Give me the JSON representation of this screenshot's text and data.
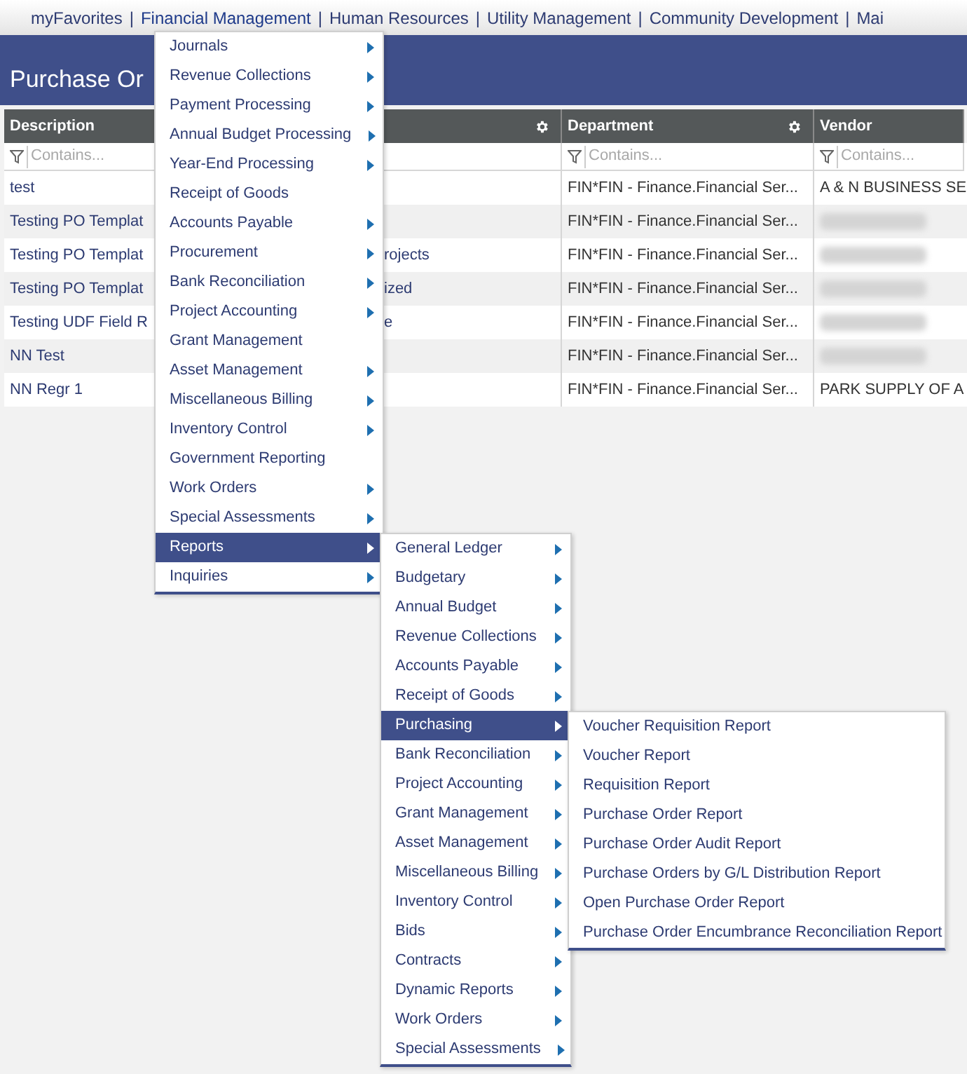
{
  "nav": {
    "items": [
      {
        "label": "myFavorites",
        "selected": false
      },
      {
        "label": "Financial Management",
        "selected": true
      },
      {
        "label": "Human Resources",
        "selected": false
      },
      {
        "label": "Utility Management",
        "selected": false
      },
      {
        "label": "Community Development",
        "selected": false
      },
      {
        "label": "Mai",
        "selected": false
      }
    ],
    "separator": "|"
  },
  "page_title": "Purchase Or",
  "table": {
    "columns": [
      {
        "label": "Description",
        "settings": true,
        "filter_placeholder": "Contains..."
      },
      {
        "label": "Department",
        "settings": true,
        "filter_placeholder": "Contains..."
      },
      {
        "label": "Vendor",
        "settings": false,
        "filter_placeholder": "Contains..."
      }
    ],
    "rows": [
      {
        "description": "test",
        "description_tail": "",
        "department": "FIN*FIN - Finance.Financial Ser...",
        "vendor": "A & N BUSINESS SE",
        "vendor_blurred": false
      },
      {
        "description": "Testing PO Templat",
        "description_tail": "",
        "department": "FIN*FIN - Finance.Financial Ser...",
        "vendor": "",
        "vendor_blurred": true
      },
      {
        "description": "Testing PO Templat",
        "description_tail": "rojects",
        "department": "FIN*FIN - Finance.Financial Ser...",
        "vendor": "",
        "vendor_blurred": true
      },
      {
        "description": "Testing PO Templat",
        "description_tail": "ized",
        "department": "FIN*FIN - Finance.Financial Ser...",
        "vendor": "",
        "vendor_blurred": true
      },
      {
        "description": "Testing UDF Field R",
        "description_tail": "e",
        "department": "FIN*FIN - Finance.Financial Ser...",
        "vendor": "",
        "vendor_blurred": true
      },
      {
        "description": "NN Test",
        "description_tail": "",
        "department": "FIN*FIN - Finance.Financial Ser...",
        "vendor": "",
        "vendor_blurred": true
      },
      {
        "description": "NN Regr 1",
        "description_tail": "",
        "department": "FIN*FIN - Finance.Financial Ser...",
        "vendor": "PARK SUPPLY OF A",
        "vendor_blurred": false
      }
    ]
  },
  "menus": [
    {
      "items": [
        {
          "label": "Journals",
          "has_submenu": true,
          "selected": false
        },
        {
          "label": "Revenue Collections",
          "has_submenu": true,
          "selected": false
        },
        {
          "label": "Payment Processing",
          "has_submenu": true,
          "selected": false
        },
        {
          "label": "Annual Budget Processing",
          "has_submenu": true,
          "selected": false
        },
        {
          "label": "Year-End Processing",
          "has_submenu": true,
          "selected": false
        },
        {
          "label": "Receipt of Goods",
          "has_submenu": false,
          "selected": false
        },
        {
          "label": "Accounts Payable",
          "has_submenu": true,
          "selected": false
        },
        {
          "label": "Procurement",
          "has_submenu": true,
          "selected": false
        },
        {
          "label": "Bank Reconciliation",
          "has_submenu": true,
          "selected": false
        },
        {
          "label": "Project Accounting",
          "has_submenu": true,
          "selected": false
        },
        {
          "label": "Grant Management",
          "has_submenu": false,
          "selected": false
        },
        {
          "label": "Asset Management",
          "has_submenu": true,
          "selected": false
        },
        {
          "label": "Miscellaneous Billing",
          "has_submenu": true,
          "selected": false
        },
        {
          "label": "Inventory Control",
          "has_submenu": true,
          "selected": false
        },
        {
          "label": "Government Reporting",
          "has_submenu": false,
          "selected": false
        },
        {
          "label": "Work Orders",
          "has_submenu": true,
          "selected": false
        },
        {
          "label": "Special Assessments",
          "has_submenu": true,
          "selected": false
        },
        {
          "label": "Reports",
          "has_submenu": true,
          "selected": true
        },
        {
          "label": "Inquiries",
          "has_submenu": true,
          "selected": false
        }
      ]
    },
    {
      "items": [
        {
          "label": "General Ledger",
          "has_submenu": true,
          "selected": false
        },
        {
          "label": "Budgetary",
          "has_submenu": true,
          "selected": false
        },
        {
          "label": "Annual Budget",
          "has_submenu": true,
          "selected": false
        },
        {
          "label": "Revenue Collections",
          "has_submenu": true,
          "selected": false
        },
        {
          "label": "Accounts Payable",
          "has_submenu": true,
          "selected": false
        },
        {
          "label": "Receipt of Goods",
          "has_submenu": true,
          "selected": false
        },
        {
          "label": "Purchasing",
          "has_submenu": true,
          "selected": true
        },
        {
          "label": "Bank Reconciliation",
          "has_submenu": true,
          "selected": false
        },
        {
          "label": "Project Accounting",
          "has_submenu": true,
          "selected": false
        },
        {
          "label": "Grant Management",
          "has_submenu": true,
          "selected": false
        },
        {
          "label": "Asset Management",
          "has_submenu": true,
          "selected": false
        },
        {
          "label": "Miscellaneous Billing",
          "has_submenu": true,
          "selected": false
        },
        {
          "label": "Inventory Control",
          "has_submenu": true,
          "selected": false
        },
        {
          "label": "Bids",
          "has_submenu": true,
          "selected": false
        },
        {
          "label": "Contracts",
          "has_submenu": true,
          "selected": false
        },
        {
          "label": "Dynamic Reports",
          "has_submenu": true,
          "selected": false
        },
        {
          "label": "Work Orders",
          "has_submenu": true,
          "selected": false
        },
        {
          "label": "Special Assessments",
          "has_submenu": true,
          "selected": false
        }
      ]
    },
    {
      "items": [
        {
          "label": "Voucher Requisition Report",
          "selected": false
        },
        {
          "label": "Voucher Report",
          "selected": false
        },
        {
          "label": "Requisition Report",
          "selected": false
        },
        {
          "label": "Purchase Order Report",
          "selected": false
        },
        {
          "label": "Purchase Order Audit Report",
          "selected": false
        },
        {
          "label": "Purchase Orders by G/L Distribution Report",
          "selected": false
        },
        {
          "label": "Open Purchase Order Report",
          "selected": false
        },
        {
          "label": "Purchase Order Encumbrance Reconciliation Report",
          "selected": false
        }
      ]
    }
  ]
}
